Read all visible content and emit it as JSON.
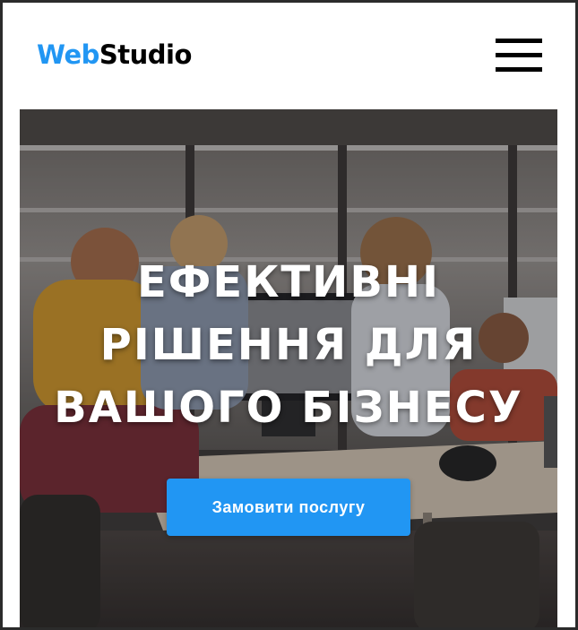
{
  "header": {
    "logo": {
      "part_a": "Web",
      "part_b": "Studio"
    },
    "menu_icon": "hamburger-menu-icon"
  },
  "hero": {
    "title_lines": [
      "ЕФЕКТИВНІ",
      "РІШЕННЯ ДЛЯ",
      "ВАШОГО БІЗНЕСУ"
    ],
    "cta_label": "Замовити послугу",
    "background": "office-team-photo"
  },
  "colors": {
    "accent": "#2196f3",
    "text_dark": "#000000",
    "text_light": "#ffffff"
  }
}
